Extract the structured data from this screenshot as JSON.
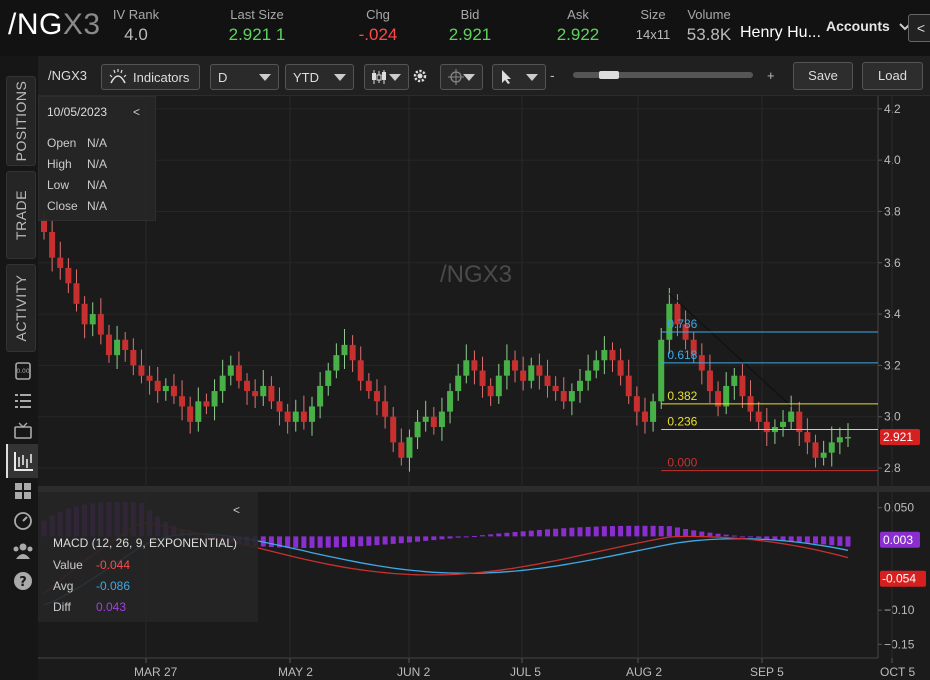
{
  "header": {
    "symbol_main": "/NG",
    "symbol_suffix": "X3",
    "iv_rank": {
      "label": "IV Rank",
      "value": "4.0"
    },
    "last_size": {
      "label": "Last Size",
      "value": "2.921 1"
    },
    "chg": {
      "label": "Chg",
      "value": "-.024"
    },
    "bid": {
      "label": "Bid",
      "value": "2.921"
    },
    "ask": {
      "label": "Ask",
      "value": "2.922"
    },
    "size": {
      "label": "Size",
      "value": "14x11"
    },
    "volume": {
      "label": "Volume",
      "value": "53.8K"
    },
    "user": "Henry Hu...",
    "accounts": "Accounts",
    "collapse_glyph": "<"
  },
  "sidebar": {
    "tabs": [
      "POSITIONS",
      "TRADE",
      "ACTIVITY"
    ],
    "icons": [
      "watchlist-icon",
      "list-icon",
      "tv-icon",
      "chart-icon",
      "grid-icon",
      "dashboard-icon",
      "community-icon",
      "help-icon"
    ]
  },
  "toolbar": {
    "symbol": "/NGX3",
    "indicators": "Indicators",
    "interval": "D",
    "range": "YTD",
    "zoom_minus": "-",
    "zoom_plus": "+",
    "save": "Save",
    "load": "Load"
  },
  "infobox": {
    "date": "10/05/2023",
    "collapse": "<",
    "rows": [
      {
        "label": "Open",
        "value": "N/A"
      },
      {
        "label": "High",
        "value": "N/A"
      },
      {
        "label": "Low",
        "value": "N/A"
      },
      {
        "label": "Close",
        "value": "N/A"
      }
    ]
  },
  "macd": {
    "title": "MACD (12, 26, 9, EXPONENTIAL)",
    "collapse": "<",
    "rows": [
      {
        "label": "Value",
        "value": "-0.044",
        "color": "#ff4a4a"
      },
      {
        "label": "Avg",
        "value": "-0.086",
        "color": "#3fa9e6"
      },
      {
        "label": "Diff",
        "value": "0.043",
        "color": "#a040e0"
      }
    ]
  },
  "chart_data": {
    "type": "candlestick",
    "watermark": "/NGX3",
    "price_axis": {
      "ticks": [
        "4.2",
        "4.0",
        "3.8",
        "3.6",
        "3.4",
        "3.2",
        "3.0",
        "2.8"
      ],
      "range": [
        2.73,
        4.25
      ]
    },
    "macd_axis": {
      "ticks": [
        "0.050",
        "−0.10",
        "−0.15"
      ],
      "range": [
        -0.17,
        0.07
      ]
    },
    "date_ticks": [
      "MAR 27",
      "MAY 2",
      "JUN 2",
      "JUL 5",
      "AUG 2",
      "SEP 5",
      "OCT 5"
    ],
    "last_price": "2.921",
    "macd_avg_tag": "0.003",
    "macd_value_tag": "-0.054",
    "fib_levels": [
      {
        "label": "0.786",
        "price": 3.33,
        "color": "#3fa9e6"
      },
      {
        "label": "0.618",
        "price": 3.21,
        "color": "#3fa9e6"
      },
      {
        "label": "0.382",
        "price": 3.05,
        "color": "#e6e02a"
      },
      {
        "label": "0.236",
        "price": 2.95,
        "color": "#e6e02a"
      },
      {
        "label": "0.000",
        "price": 2.79,
        "color": "#c83030"
      }
    ],
    "closes": [
      3.72,
      3.62,
      3.58,
      3.52,
      3.44,
      3.36,
      3.4,
      3.32,
      3.24,
      3.3,
      3.26,
      3.2,
      3.16,
      3.14,
      3.1,
      3.12,
      3.08,
      3.04,
      2.98,
      3.06,
      3.04,
      3.1,
      3.16,
      3.2,
      3.14,
      3.1,
      3.08,
      3.12,
      3.06,
      3.02,
      2.98,
      3.02,
      2.98,
      3.04,
      3.12,
      3.18,
      3.24,
      3.28,
      3.22,
      3.14,
      3.1,
      3.06,
      3.0,
      2.9,
      2.84,
      2.92,
      2.98,
      3.0,
      2.96,
      3.02,
      3.1,
      3.16,
      3.22,
      3.18,
      3.12,
      3.08,
      3.16,
      3.22,
      3.18,
      3.14,
      3.2,
      3.16,
      3.12,
      3.1,
      3.06,
      3.1,
      3.14,
      3.18,
      3.22,
      3.26,
      3.22,
      3.16,
      3.08,
      3.02,
      2.98,
      3.06,
      3.3,
      3.44,
      3.36,
      3.3,
      3.24,
      3.18,
      3.1,
      3.04,
      3.12,
      3.16,
      3.08,
      3.02,
      2.98,
      2.94,
      2.96,
      2.98,
      3.02,
      2.94,
      2.9,
      2.84,
      2.86,
      2.9,
      2.92,
      2.921
    ]
  }
}
